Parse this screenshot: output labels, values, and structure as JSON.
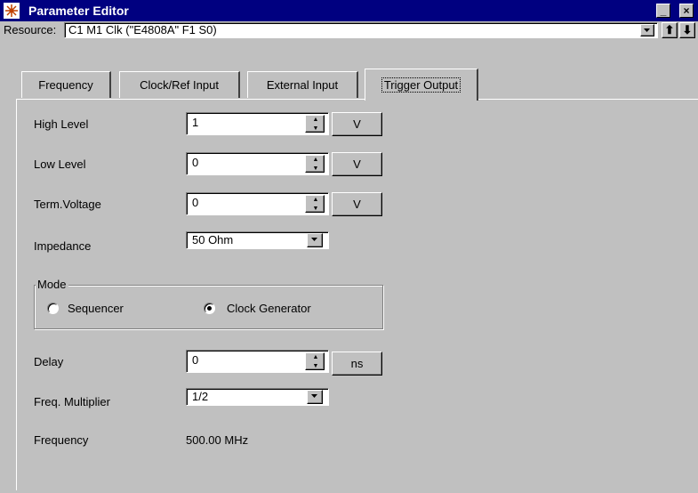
{
  "window": {
    "title": "Parameter Editor",
    "minimize": "_",
    "close": "×"
  },
  "resource": {
    "label": "Resource:",
    "value": "C1 M1 Clk (\"E4808A\" F1 S0)",
    "up_arrow": "⬆",
    "down_arrow": "⬇"
  },
  "tabs": [
    {
      "label": "Frequency"
    },
    {
      "label": "Clock/Ref Input"
    },
    {
      "label": "External Input"
    },
    {
      "label": "Trigger Output",
      "active": true
    }
  ],
  "fields": {
    "high_level": {
      "label": "High Level",
      "value": "1",
      "unit": "V"
    },
    "low_level": {
      "label": "Low Level",
      "value": "0",
      "unit": "V"
    },
    "term_voltage": {
      "label": "Term.Voltage",
      "value": "0",
      "unit": "V"
    },
    "impedance": {
      "label": "Impedance",
      "value": "50 Ohm"
    },
    "delay": {
      "label": "Delay",
      "value": "0",
      "unit": "ns"
    },
    "freq_multiplier": {
      "label": "Freq. Multiplier",
      "value": "1/2"
    },
    "frequency": {
      "label": "Frequency",
      "value": "500.00 MHz"
    }
  },
  "mode": {
    "title": "Mode",
    "options": [
      {
        "label": "Sequencer",
        "selected": false
      },
      {
        "label": "Clock Generator",
        "selected": true
      }
    ]
  },
  "colors": {
    "titlebar": "#000080",
    "face": "#c0c0c0"
  }
}
